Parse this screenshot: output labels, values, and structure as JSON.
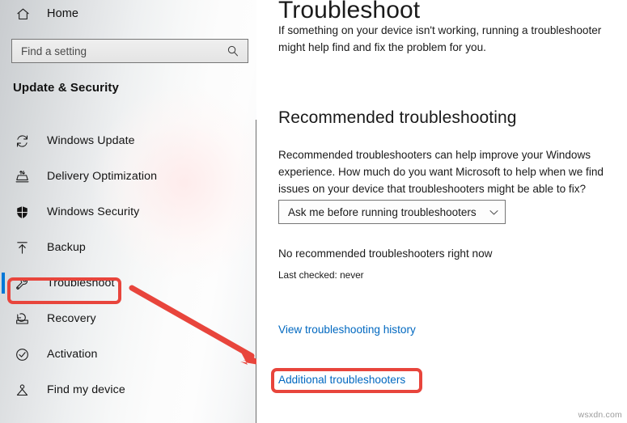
{
  "sidebar": {
    "home": {
      "label": "Home",
      "icon": "home-icon"
    },
    "search": {
      "value": "",
      "placeholder": "Find a setting",
      "icon": "search-icon"
    },
    "section_title": "Update & Security",
    "items": [
      {
        "label": "Windows Update",
        "icon": "sync-icon",
        "selected": false
      },
      {
        "label": "Delivery Optimization",
        "icon": "delivery-optimization-icon",
        "selected": false
      },
      {
        "label": "Windows Security",
        "icon": "shield-icon",
        "selected": false
      },
      {
        "label": "Backup",
        "icon": "upload-arrow-icon",
        "selected": false
      },
      {
        "label": "Troubleshoot",
        "icon": "wrench-icon",
        "selected": true
      },
      {
        "label": "Recovery",
        "icon": "recovery-icon",
        "selected": false
      },
      {
        "label": "Activation",
        "icon": "check-circle-icon",
        "selected": false
      },
      {
        "label": "Find my device",
        "icon": "find-device-icon",
        "selected": false
      }
    ]
  },
  "main": {
    "title": "Troubleshoot",
    "intro": "If something on your device isn't working, running a troubleshooter might help find and fix the problem for you.",
    "recommended": {
      "heading": "Recommended troubleshooting",
      "body": "Recommended troubleshooters can help improve your Windows experience. How much do you want Microsoft to help when we find issues on your device that troubleshooters might be able to fix?",
      "dropdown": {
        "selected": "Ask me before running troubleshooters",
        "icon": "chevron-down-icon"
      },
      "status_main": "No recommended troubleshooters right now",
      "status_sub": "Last checked: never"
    },
    "links": [
      {
        "label": "View troubleshooting history"
      },
      {
        "label": "Additional troubleshooters"
      }
    ]
  },
  "annotations": {
    "highlight_color": "#e8453c",
    "accent_color": "#0078d7",
    "link_color": "#0068c0",
    "arrow": "red-arrow-annotation"
  },
  "watermark": "wsxdn.com"
}
